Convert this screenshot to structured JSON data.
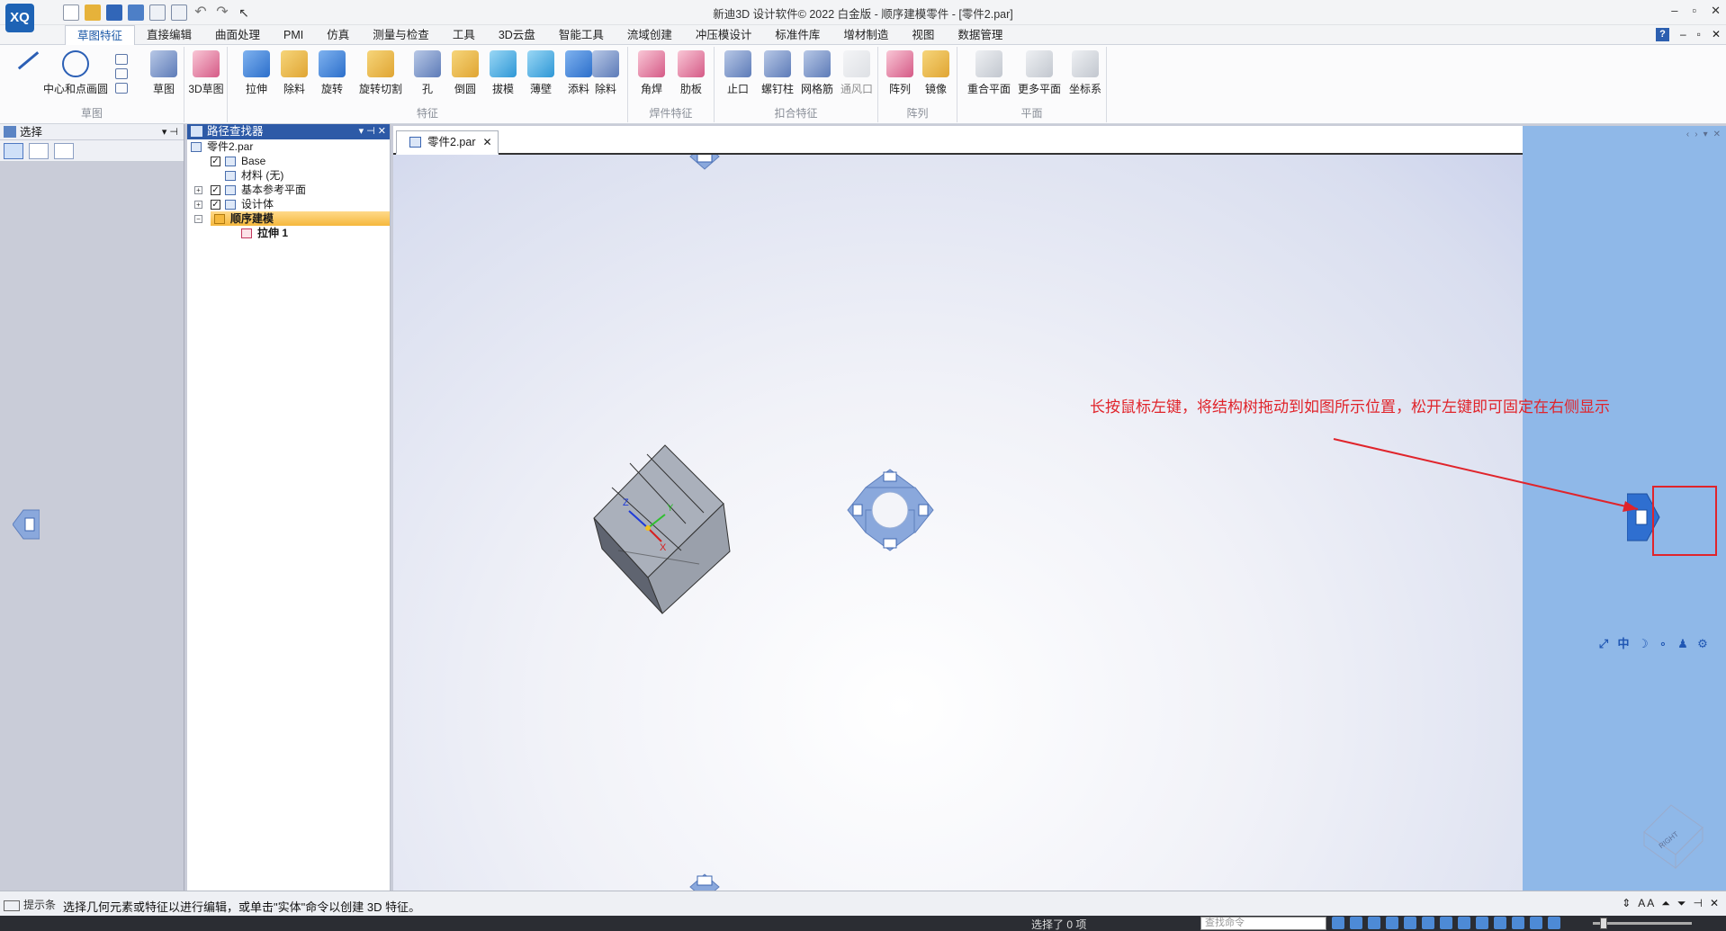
{
  "app": {
    "logo_text": "XQ",
    "title": "新迪3D 设计软件© 2022 白金版 - 顺序建模零件 - [零件2.par]",
    "win_minimize": "–",
    "win_restore": "▫",
    "win_close": "✕"
  },
  "ribbon_tabs": [
    "草图特征",
    "直接编辑",
    "曲面处理",
    "PMI",
    "仿真",
    "测量与检查",
    "工具",
    "3D云盘",
    "智能工具",
    "流域创建",
    "冲压模设计",
    "标准件库",
    "增材制造",
    "视图",
    "数据管理"
  ],
  "ribbon_groups": {
    "sketch": {
      "label": "草图",
      "btn_line": "",
      "btn_circle": "中心和点画圆",
      "btn_sketch": "草图",
      "btn_3d": "3D草图"
    },
    "feature": {
      "label": "特征",
      "buttons": [
        "拉伸",
        "除料",
        "旋转",
        "旋转切割",
        "孔",
        "倒圆",
        "拔模",
        "薄壁",
        "添料",
        "除料"
      ]
    },
    "weld": {
      "label": "焊件特征",
      "buttons": [
        "角焊",
        "肋板"
      ]
    },
    "snap": {
      "label": "扣合特征",
      "buttons": [
        "止口",
        "螺钉柱",
        "网格筋",
        "通风口"
      ]
    },
    "pattern": {
      "label": "阵列",
      "buttons": [
        "阵列",
        "镜像"
      ]
    },
    "plane": {
      "label": "平面",
      "buttons": [
        "重合平面",
        "更多平面",
        "坐标系"
      ]
    }
  },
  "select_panel": {
    "title": "选择"
  },
  "pathfinder": {
    "title": "路径查找器",
    "items": [
      {
        "label": "零件2.par"
      },
      {
        "label": "Base",
        "checked": "✓"
      },
      {
        "label": "材料 (无)"
      },
      {
        "label": "基本参考平面",
        "checked": "✓",
        "expander": "+"
      },
      {
        "label": "设计体",
        "checked": "✓",
        "expander": "+"
      },
      {
        "label": "顺序建模",
        "expander": "−"
      },
      {
        "label": "拉伸 1"
      }
    ]
  },
  "document": {
    "tab_label": "零件2.par",
    "close": "✕"
  },
  "annotation": {
    "text": "长按鼠标左键，将结构树拖动到如图所示位置，松开左键即可固定在右侧显示",
    "color": "#e0242b"
  },
  "axes": {
    "z": "Z",
    "y": "Y",
    "x": "X"
  },
  "view_cube": {
    "label": "RIGHT"
  },
  "view_toolbar": [
    "⤢",
    "中",
    "☽",
    "∘",
    "♟",
    "⚙"
  ],
  "hintbar": {
    "label": "提示条",
    "text": "选择几何元素或特征以进行编辑，或单击\"实体\"命令以创建 3D 特征。"
  },
  "statusbar": {
    "selected": "选择了 0 项",
    "search_placeholder": "查找命令"
  },
  "colors": {
    "accent": "#2d5aa7",
    "dock_zone": "#8fb8e8",
    "annotation": "#e0242b"
  }
}
